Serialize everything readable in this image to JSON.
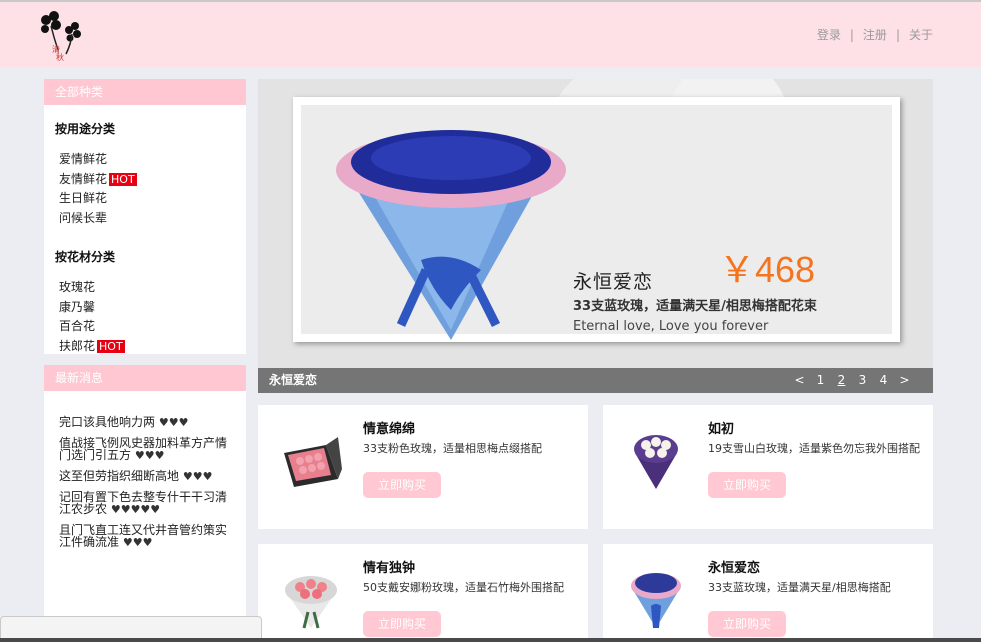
{
  "header": {
    "links": [
      "登录",
      "注册",
      "关于"
    ],
    "separator": "|"
  },
  "categories": {
    "title": "全部种类",
    "groups": [
      {
        "title": "按用途分类",
        "items": [
          {
            "label": "爱情鲜花",
            "hot": ""
          },
          {
            "label": "友情鲜花",
            "hot": "HOT"
          },
          {
            "label": "生日鲜花",
            "hot": ""
          },
          {
            "label": "问候长辈",
            "hot": ""
          }
        ]
      },
      {
        "title": "按花材分类",
        "items": [
          {
            "label": "玫瑰花",
            "hot": ""
          },
          {
            "label": "康乃馨",
            "hot": ""
          },
          {
            "label": "百合花",
            "hot": ""
          },
          {
            "label": "扶郎花",
            "hot": "HOT"
          }
        ]
      }
    ]
  },
  "news": {
    "title": "最新消息",
    "items": [
      {
        "text": "完口该具他响力两",
        "hearts": "♥♥♥"
      },
      {
        "text": "值战接飞例风史器加料革方产情门选门引五方",
        "hearts": "♥♥♥"
      },
      {
        "text": "这至但劳指织细断高地",
        "hearts": "♥♥♥"
      },
      {
        "text": "记回有置下色去整专什干干习清江农步农",
        "hearts": "♥♥♥♥♥"
      },
      {
        "text": "且门飞直工连又代井音管约策实江件确流准",
        "hearts": "♥♥♥"
      }
    ]
  },
  "banner": {
    "title": "永恒爱恋",
    "price": "￥468",
    "desc": "33支蓝玫瑰，适量满天星/相思梅搭配花束",
    "english": "Eternal love, Love you forever",
    "caption": "永恒爱恋",
    "pager": [
      "<",
      "1",
      "2",
      "3",
      "4",
      ">"
    ],
    "active_page": "2"
  },
  "products": [
    {
      "name": "情意绵绵",
      "desc": "33支粉色玫瑰，适量相思梅点缀搭配",
      "button": "立即购买",
      "color": "#e87f8e"
    },
    {
      "name": "如初",
      "desc": "19支雪山白玫瑰，适量紫色勿忘我外围搭配",
      "button": "立即购买",
      "color": "#f1efe6"
    },
    {
      "name": "情有独钟",
      "desc": "50支戴安娜粉玫瑰，适量石竹梅外围搭配",
      "button": "立即购买",
      "color": "#f0808a"
    },
    {
      "name": "永恒爱恋",
      "desc": "33支蓝玫瑰，适量满天星/相思梅搭配",
      "button": "立即购买",
      "color": "#2d3a9a"
    }
  ],
  "colors": {
    "header_bg": "#fde1e7",
    "accent_pink": "#ffc7d2",
    "price_orange": "#f5741e",
    "hot_red": "#e60012"
  }
}
